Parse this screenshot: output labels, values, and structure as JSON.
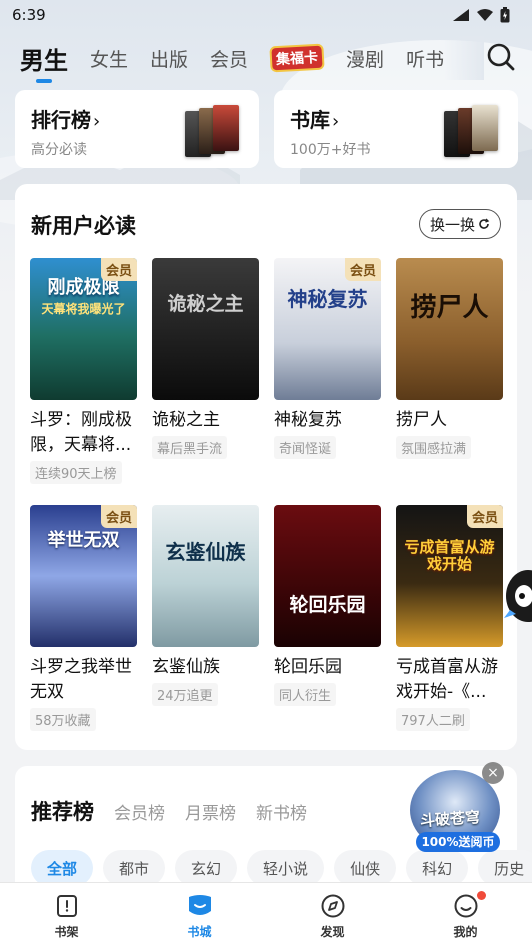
{
  "status_bar": {
    "time": "6:39"
  },
  "top_tabs": [
    {
      "label": "男生",
      "active": true
    },
    {
      "label": "女生"
    },
    {
      "label": "出版"
    },
    {
      "label": "会员"
    },
    {
      "label": "集福卡",
      "badge": true
    },
    {
      "label": "漫剧"
    },
    {
      "label": "听书"
    }
  ],
  "quick_links": [
    {
      "title": "排行榜",
      "chevron": "›",
      "subtitle": "高分必读"
    },
    {
      "title": "书库",
      "chevron": "›",
      "subtitle": "100万+好书"
    }
  ],
  "new_user_section": {
    "title": "新用户必读",
    "swap_label": "换一换",
    "books": [
      {
        "title": "斗罗：刚成极限，天幕将...",
        "tag": "连续90天上榜",
        "vip": "会员",
        "cover_text": "刚成极限",
        "cover_sub": "天幕将我曝光了"
      },
      {
        "title": "诡秘之主",
        "tag": "幕后黑手流",
        "vip": "",
        "cover_text": "诡秘之主",
        "cover_sub": ""
      },
      {
        "title": "神秘复苏",
        "tag": "奇闻怪诞",
        "vip": "会员",
        "cover_text": "神秘复苏",
        "cover_sub": ""
      },
      {
        "title": "捞尸人",
        "tag": "氛围感拉满",
        "vip": "",
        "cover_text": "捞尸人",
        "cover_sub": ""
      },
      {
        "title": "斗罗之我举世无双",
        "tag": "58万收藏",
        "vip": "会员",
        "cover_text": "举世无双",
        "cover_sub": ""
      },
      {
        "title": "玄鉴仙族",
        "tag": "24万追更",
        "vip": "",
        "cover_text": "玄鉴仙族",
        "cover_sub": ""
      },
      {
        "title": "轮回乐园",
        "tag": "同人衍生",
        "vip": "",
        "cover_text": "轮回乐园",
        "cover_sub": ""
      },
      {
        "title": "亏成首富从游戏开始-《...",
        "tag": "797人二刷",
        "vip": "会员",
        "cover_text": "亏成首富从游戏开始",
        "cover_sub": ""
      }
    ]
  },
  "rank_section": {
    "tabs": [
      "推荐榜",
      "会员榜",
      "月票榜",
      "新书榜"
    ],
    "chips": [
      "全部",
      "都市",
      "玄幻",
      "轻小说",
      "仙侠",
      "科幻",
      "历史"
    ]
  },
  "promo": {
    "title": "斗破苍穹",
    "label": "100%送阅币",
    "close": "×"
  },
  "bottom_nav": [
    {
      "label": "书架",
      "icon": "bookshelf-icon"
    },
    {
      "label": "书城",
      "icon": "bookstore-icon",
      "active": true
    },
    {
      "label": "发现",
      "icon": "compass-icon"
    },
    {
      "label": "我的",
      "icon": "profile-icon"
    }
  ],
  "colors": {
    "accent": "#1e88e5",
    "vip_bg": "#f4e1b8",
    "vip_text": "#7a4f12"
  }
}
